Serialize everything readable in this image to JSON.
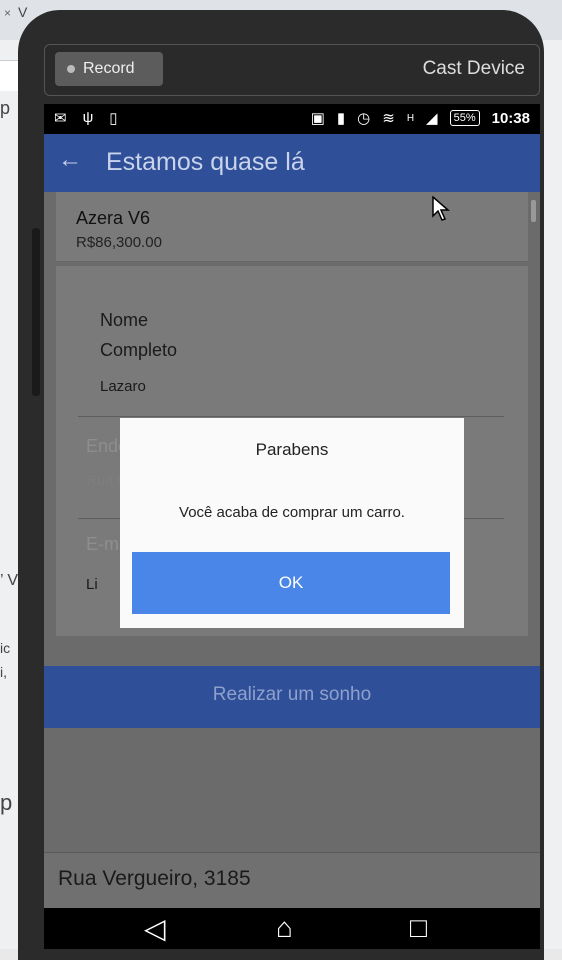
{
  "browser": {
    "tab_close": "×",
    "tab_fragment": "V",
    "left_fragments": [
      "p",
      "’ V",
      "ic",
      "i,",
      "p"
    ]
  },
  "cast_bar": {
    "record_label": "Record",
    "cast_label": "Cast Device"
  },
  "status_bar": {
    "battery": "55%",
    "time": "10:38",
    "network": "H",
    "icons": [
      "mail-icon",
      "signal-antenna-icon",
      "sim-icon",
      "cast-icon",
      "vibrate-icon",
      "alarm-icon",
      "wifi-icon",
      "cell-signal-icon",
      "battery-icon"
    ]
  },
  "app_bar": {
    "back_icon": "arrow-left-icon",
    "title": "Estamos quase lá"
  },
  "product": {
    "name": "Azera V6",
    "price": "R$86,300.00"
  },
  "form": {
    "name_label_line1": "Nome",
    "name_label_line2": "Completo",
    "name_value": "Lazaro",
    "address_label": "Endereço",
    "address_value": "Rua teste",
    "email_label": "E-mail",
    "email_value": "Li"
  },
  "cta": {
    "label": "Realizar um sonho"
  },
  "footer": {
    "address": "Rua Vergueiro, 3185"
  },
  "dialog": {
    "title": "Parabens",
    "message": "Você acaba de comprar um carro.",
    "ok_label": "OK"
  },
  "nav": {
    "icons": [
      "back-triangle-icon",
      "home-icon",
      "recents-icon"
    ]
  },
  "colors": {
    "primary": "#2f4f99",
    "button": "#4a86e8",
    "scrim": "#6b6b6b"
  }
}
